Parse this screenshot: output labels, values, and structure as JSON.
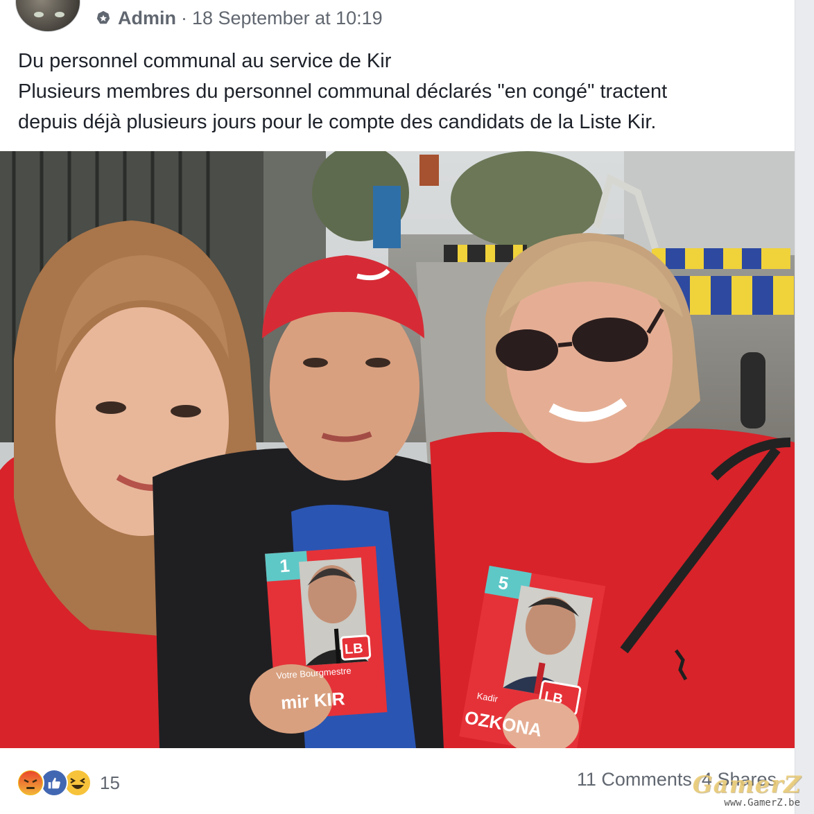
{
  "post": {
    "author": "Admin",
    "separator": "·",
    "timestamp": "18 September at 10:19",
    "text_lines": [
      "Du personnel communal au service de Kir",
      "Plusieurs membres du personnel communal déclarés \"en congé\" tractent",
      "depuis déjà plusieurs jours pour le compte des candidats de la Liste Kir."
    ]
  },
  "photo": {
    "flyers": [
      {
        "number": "1",
        "logo": "LB",
        "caption": "Votre Bourgmestre",
        "name": "mir KIR"
      },
      {
        "number": "5",
        "logo": "LB",
        "caption": "Kadir",
        "name": "OZKONA"
      }
    ]
  },
  "footer": {
    "reactions": [
      "angry-reaction-icon",
      "like-reaction-icon",
      "haha-reaction-icon"
    ],
    "reaction_count": "15",
    "comments": "11 Comments",
    "shares": "4 Shares"
  },
  "watermark": {
    "logo": "GamerZ",
    "url": "www.GamerZ.be"
  },
  "colors": {
    "facebook_blue": "#4267b2",
    "text_dark": "#1d2129",
    "text_grey": "#616770",
    "shirt_red": "#d8232a"
  }
}
